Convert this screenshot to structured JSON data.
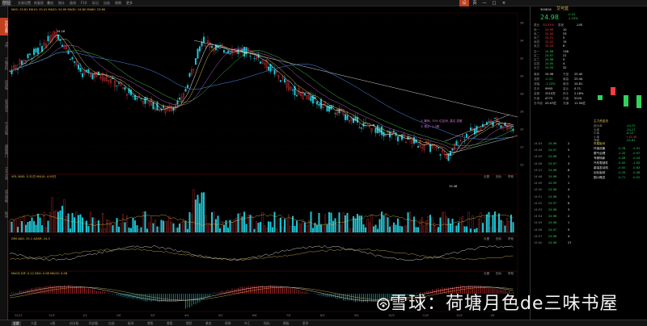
{
  "toolbar": {
    "items": [
      "交易设置",
      "前复权",
      "叠加",
      "统计",
      "画线",
      "F10",
      "标记",
      "自选",
      "周期",
      "更多"
    ],
    "tag": "创业板",
    "right_items": [
      "设",
      "页",
      "—",
      "□",
      "×"
    ]
  },
  "leftbar": {
    "items": [
      "分时走势",
      "K线",
      "个股资料",
      "自选股",
      "综合排名",
      "牛叉诊股",
      "超级盘口",
      "主力大单",
      "成交明细",
      "板块"
    ]
  },
  "chart": {
    "main_legend": "MA5: 25.81  MA10: 25.41  MA20: 24.99  MA30: 24.80  MA60: 23.60",
    "annotation_1": "① 筹码: 70% 位区间, 高位 发散",
    "annotation_2": "② 预示: 1-3周",
    "high_label": "34.18",
    "low_label": "19.48",
    "vol_legend": "VOL  MA5: 5.31万  MA10: 4.95万",
    "kdj_legend": "DMI  ADX: 25.1  ADXR: 24.3",
    "macd_legend": "MACD  DIF: 0.12  DEA: 0.08  MACD: 0.08",
    "panel_tools": [
      "设置",
      "指标",
      "帮助"
    ],
    "date_ticks": [
      "22/11",
      "12/5",
      "1/3",
      "2/6",
      "3/3",
      "4/4",
      "5/5",
      "6/6",
      "7/5",
      "8/3",
      "9/4",
      "10/9",
      "11/6",
      "12/4",
      "1/6"
    ],
    "price_ticks": [
      "36",
      "34",
      "32",
      "30",
      "28",
      "26",
      "24",
      "22",
      "20"
    ],
    "colors": {
      "up": "#ff3c3c",
      "down": "#1ec8d8",
      "ma5": "#ffffff",
      "ma10": "#e6c34a",
      "ma20": "#c060d0",
      "ma30": "#40c040",
      "ma60": "#5090ff"
    }
  },
  "quote": {
    "code": "300816",
    "name": "艾可蓝",
    "price": "24.98",
    "change": "-0.31",
    "pct": "-1.23%",
    "ratio_label": "委比",
    "ratio": "-33.33%",
    "diff_label": "委差",
    "diff": "-145",
    "sell": [
      {
        "label": "卖五",
        "price": "25.03",
        "vol": "6"
      },
      {
        "label": "卖四",
        "price": "25.02",
        "vol": "15"
      },
      {
        "label": "卖三",
        "price": "25.01",
        "vol": "5"
      },
      {
        "label": "卖二",
        "price": "25.00",
        "vol": "53"
      },
      {
        "label": "卖一",
        "price": "24.99",
        "vol": "10"
      }
    ],
    "buy": [
      {
        "label": "买一",
        "price": "24.98",
        "vol": "138"
      },
      {
        "label": "买二",
        "price": "24.97",
        "vol": "21"
      },
      {
        "label": "买三",
        "price": "24.96",
        "vol": "5"
      },
      {
        "label": "买四",
        "price": "24.95",
        "vol": "4"
      },
      {
        "label": "买五",
        "price": "24.94",
        "vol": "32"
      }
    ],
    "stats": [
      {
        "k": "最新",
        "v": "24.98",
        "k2": "开盘",
        "v2": "25.40"
      },
      {
        "k": "涨跌",
        "v": "-0.31",
        "k2": "最高",
        "v2": "25.44"
      },
      {
        "k": "涨幅",
        "v": "-1.23%",
        "k2": "最低",
        "v2": "24.81"
      },
      {
        "k": "总手",
        "v": "9993",
        "k2": "量比",
        "v2": "0.71"
      },
      {
        "k": "金额",
        "v": "2510万",
        "k2": "换手",
        "v2": "2.18%"
      },
      {
        "k": "外盘",
        "v": "4773",
        "k2": "内盘",
        "v2": "5220"
      },
      {
        "k": "总市值",
        "v": "20.07亿",
        "k2": "流通",
        "v2": "11.50亿"
      }
    ],
    "ticks": [
      {
        "t": "14:43",
        "p": "24.98",
        "v": "2"
      },
      {
        "t": "14:44",
        "p": "24.97",
        "v": "5"
      },
      {
        "t": "14:45",
        "p": "24.98",
        "v": "1"
      },
      {
        "t": "14:46",
        "p": "24.97",
        "v": "3"
      },
      {
        "t": "14:47",
        "p": "24.98",
        "v": "8"
      },
      {
        "t": "14:48",
        "p": "24.98",
        "v": "2"
      },
      {
        "t": "14:49",
        "p": "24.99",
        "v": "1"
      },
      {
        "t": "14:50",
        "p": "24.98",
        "v": "4"
      },
      {
        "t": "14:51",
        "p": "24.98",
        "v": "2"
      },
      {
        "t": "14:52",
        "p": "24.97",
        "v": "6"
      },
      {
        "t": "14:53",
        "p": "24.98",
        "v": "3"
      },
      {
        "t": "14:54",
        "p": "24.98",
        "v": "2"
      },
      {
        "t": "14:55",
        "p": "24.98",
        "v": "1"
      },
      {
        "t": "14:56",
        "p": "24.97",
        "v": "9"
      },
      {
        "t": "14:57",
        "p": "24.98",
        "v": "4"
      },
      {
        "t": "15:00",
        "p": "24.98",
        "v": "27"
      }
    ],
    "flow_header": "主力资金流",
    "flow": [
      {
        "k": "超大单",
        "v": "-14.72"
      },
      {
        "k": "大单",
        "v": "-24.27"
      },
      {
        "k": "中单",
        "v": "-6.12"
      },
      {
        "k": "小单",
        "v": "+12.30"
      },
      {
        "k": "净额",
        "v": "-32.81"
      }
    ],
    "sector_header": "所属板块",
    "sectors": [
      {
        "k": "环保设备",
        "v": "-0.78",
        "v2": "-0.91"
      },
      {
        "k": "尾气治理",
        "v": "-1.20",
        "v2": "-0.97"
      },
      {
        "k": "专精特新",
        "v": "-0.56",
        "v2": "-0.24"
      },
      {
        "k": "汽车零部件",
        "v": "-0.45",
        "v2": "-1.05"
      },
      {
        "k": "柴油发动机",
        "v": "-0.92",
        "v2": "-0.63"
      },
      {
        "k": "创业板综",
        "v": "-0.33",
        "v2": "-0.48"
      },
      {
        "k": "国六概念",
        "v": "-0.71",
        "v2": "-0.52"
      }
    ]
  },
  "bottom_tabs": [
    "全部",
    "大盘",
    "A股",
    "创业板",
    "科创板",
    "自选",
    "板块",
    "港股",
    "美股",
    "期货",
    "基金",
    "债券",
    "外汇",
    "指标",
    "模板",
    "更多"
  ],
  "watermark": {
    "text": "雪球：荷塘月色de三味书屋"
  }
}
